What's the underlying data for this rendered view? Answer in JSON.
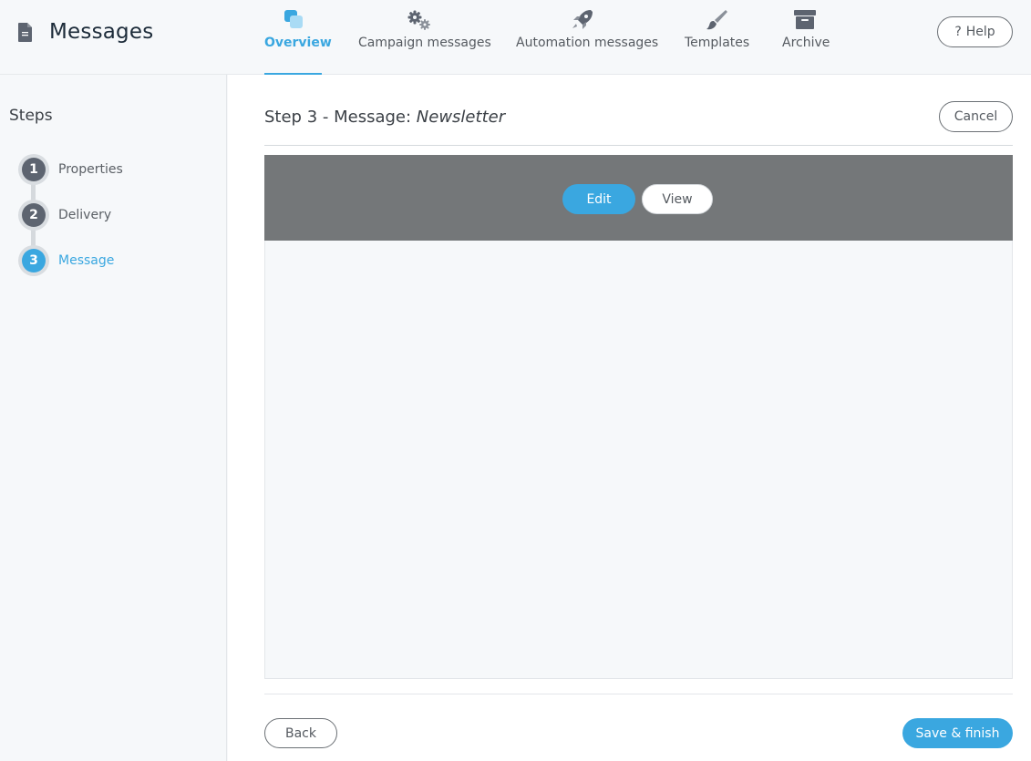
{
  "app": {
    "title": "Messages"
  },
  "nav": {
    "items": [
      {
        "label": "Overview",
        "icon": "overview-icon",
        "active": true
      },
      {
        "label": "Campaign messages",
        "icon": "gears-icon",
        "active": false
      },
      {
        "label": "Automation messages",
        "icon": "rocket-icon",
        "active": false
      },
      {
        "label": "Templates",
        "icon": "paintbrush-icon",
        "active": false
      },
      {
        "label": "Archive",
        "icon": "archive-box-icon",
        "active": false
      }
    ]
  },
  "header": {
    "help_label": "Help",
    "help_icon": "question-mark-icon"
  },
  "sidebar": {
    "title": "Steps",
    "steps": [
      {
        "number": "1",
        "label": "Properties",
        "active": false
      },
      {
        "number": "2",
        "label": "Delivery",
        "active": false
      },
      {
        "number": "3",
        "label": "Message",
        "active": true
      }
    ]
  },
  "main": {
    "heading_prefix": "Step 3 - Message:",
    "heading_name": "Newsletter",
    "cancel_label": "Cancel",
    "editor_modes": {
      "edit_label": "Edit",
      "view_label": "View",
      "selected": "Edit"
    },
    "back_label": "Back",
    "save_label": "Save & finish"
  },
  "colors": {
    "accent": "#3aa7e0",
    "step_inactive": "#5d6470",
    "editor_bar": "#747779",
    "title": "#1c2b39"
  }
}
